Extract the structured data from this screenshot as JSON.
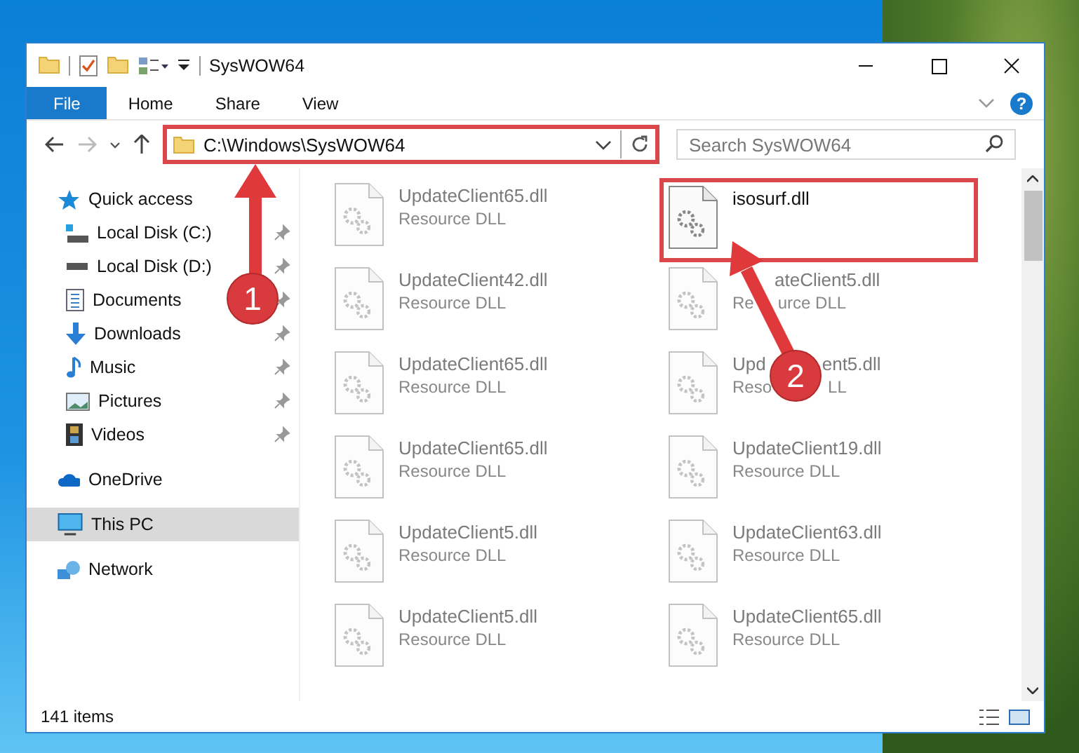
{
  "window": {
    "title": "SysWOW64"
  },
  "ribbon_tabs": [
    {
      "label": "File",
      "kind": "file",
      "selected": false
    },
    {
      "label": "Home",
      "kind": "tab",
      "selected": false
    },
    {
      "label": "Share",
      "kind": "tab",
      "selected": false
    },
    {
      "label": "View",
      "kind": "tab",
      "selected": false
    }
  ],
  "help": {
    "label": "?"
  },
  "address_bar": {
    "path": "C:\\Windows\\SysWOW64",
    "highlighted": true
  },
  "search": {
    "placeholder": "Search SysWOW64"
  },
  "sidebar": {
    "items": [
      {
        "label": "Quick access",
        "kind": "quick",
        "selected": false,
        "children": [
          {
            "label": "Local Disk (C:)",
            "kind": "diskc",
            "pinned": true,
            "selected": false
          },
          {
            "label": "Local Disk (D:)",
            "kind": "disk",
            "pinned": true,
            "selected": false
          },
          {
            "label": "Documents",
            "kind": "documents",
            "pinned": true,
            "selected": false
          },
          {
            "label": "Downloads",
            "kind": "downloads",
            "pinned": true,
            "selected": false
          },
          {
            "label": "Music",
            "kind": "music",
            "pinned": true,
            "selected": false
          },
          {
            "label": "Pictures",
            "kind": "pictures",
            "pinned": true,
            "selected": false
          },
          {
            "label": "Videos",
            "kind": "videos",
            "pinned": true,
            "selected": false
          }
        ]
      },
      {
        "label": "OneDrive",
        "kind": "onedrive",
        "selected": false
      },
      {
        "label": "This PC",
        "kind": "pc",
        "selected": true
      },
      {
        "label": "Network",
        "kind": "network",
        "selected": false
      }
    ]
  },
  "files": [
    {
      "name_parts": [
        "UpdateClient65.dll"
      ],
      "type_parts": [
        "Resource DLL"
      ],
      "faded": true,
      "highlighted": false
    },
    {
      "name_parts": [
        "isosurf.dll"
      ],
      "faded": false,
      "highlighted": true
    },
    {
      "name_parts": [
        "UpdateClient42.dll"
      ],
      "type_parts": [
        "Resource DLL"
      ],
      "faded": true,
      "highlighted": false
    },
    {
      "name_parts": [
        "ateClient5.dll"
      ],
      "type_parts": [
        "Re",
        "urce DLL"
      ],
      "faded": true,
      "highlighted": false,
      "kind": "arrow"
    },
    {
      "name_parts": [
        "UpdateClient65.dll"
      ],
      "type_parts": [
        "Resource DLL"
      ],
      "faded": true,
      "highlighted": false
    },
    {
      "name_parts": [
        "Upd",
        "ent5.dll"
      ],
      "type_parts": [
        "Reso",
        "LL"
      ],
      "faded": true,
      "highlighted": false,
      "kind": "badge"
    },
    {
      "name_parts": [
        "UpdateClient65.dll"
      ],
      "type_parts": [
        "Resource DLL"
      ],
      "faded": true,
      "highlighted": false
    },
    {
      "name_parts": [
        "UpdateClient19.dll"
      ],
      "type_parts": [
        "Resource DLL"
      ],
      "faded": true,
      "highlighted": false
    },
    {
      "name_parts": [
        "UpdateClient5.dll"
      ],
      "type_parts": [
        "Resource DLL"
      ],
      "faded": true,
      "highlighted": false
    },
    {
      "name_parts": [
        "UpdateClient63.dll"
      ],
      "type_parts": [
        "Resource DLL"
      ],
      "faded": true,
      "highlighted": false
    },
    {
      "name_parts": [
        "UpdateClient5.dll"
      ],
      "type_parts": [
        "Resource DLL"
      ],
      "faded": true,
      "highlighted": false
    },
    {
      "name_parts": [
        "UpdateClient65.dll"
      ],
      "type_parts": [
        "Resource DLL"
      ],
      "faded": true,
      "highlighted": false
    }
  ],
  "status_bar": {
    "item_count": "141 items"
  },
  "annotations": [
    {
      "number": "1"
    },
    {
      "number": "2"
    }
  ]
}
